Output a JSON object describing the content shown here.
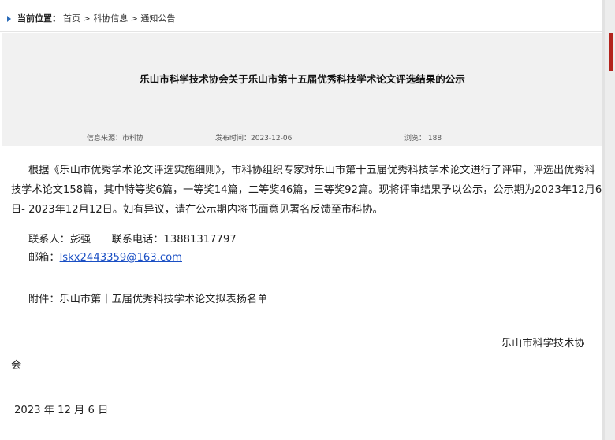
{
  "breadcrumb": {
    "label": "当前位置：",
    "path": "首页 > 科协信息 > 通知公告"
  },
  "article": {
    "title": "乐山市科学技术协会关于乐山市第十五届优秀科技学术论文评选结果的公示",
    "meta": {
      "source": "信息来源：市科协",
      "published": "发布时间：2023-12-06",
      "views": "浏览：  188"
    },
    "body": "根据《乐山市优秀学术论文评选实施细则》，市科协组织专家对乐山市第十五届优秀科技学术论文进行了评审，评选出优秀科技学术论文158篇，其中特等奖6篇，一等奖14篇，二等奖46篇，三等奖92篇。现将评审结果予以公示，公示期为2023年12月6日- 2023年12月12日。如有异议，请在公示期内将书面意见署名反馈至市科协。",
    "contact": "联系人：彭强　　联系电话：13881317797",
    "email_label": "邮箱：",
    "email": "lskx2443359@163.com",
    "attachment": "附件：乐山市第十五届优秀科技学术论文拟表扬名单",
    "signature_line1": "乐山市科学技术协",
    "signature_line2": "会",
    "date": "2023 年 12 月 6 日"
  }
}
